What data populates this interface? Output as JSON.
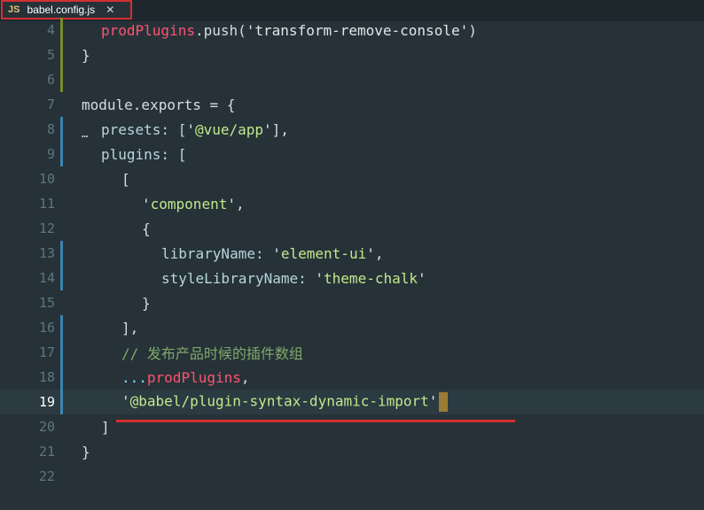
{
  "tab": {
    "icon_text": "JS",
    "filename": "babel.config.js",
    "close_glyph": "✕"
  },
  "fold_marker": "…",
  "lines": {
    "l4": {
      "num": "4",
      "fn": "prodPlugins",
      "rest": ".push(",
      "str": "'transform-remove-console'",
      "end": ")"
    },
    "l5": {
      "num": "5",
      "text": "}"
    },
    "l6": {
      "num": "6"
    },
    "l7": {
      "num": "7",
      "text": "module.exports = {"
    },
    "l8": {
      "num": "8",
      "key": "presets: [",
      "q1": "'",
      "str": "@vue/app",
      "q2": "'",
      "end": "],"
    },
    "l9": {
      "num": "9",
      "text": "plugins: ["
    },
    "l10": {
      "num": "10",
      "text": "["
    },
    "l11": {
      "num": "11",
      "q1": "'",
      "str": "component",
      "q2": "'",
      "end": ","
    },
    "l12": {
      "num": "12",
      "text": "{"
    },
    "l13": {
      "num": "13",
      "key": "libraryName: ",
      "q1": "'",
      "str": "element-ui",
      "q2": "'",
      "end": ","
    },
    "l14": {
      "num": "14",
      "key": "styleLibraryName: ",
      "q1": "'",
      "str": "theme-chalk",
      "q2": "'"
    },
    "l15": {
      "num": "15",
      "text": "}"
    },
    "l16": {
      "num": "16",
      "text": "],"
    },
    "l17": {
      "num": "17",
      "text": "// 发布产品时候的插件数组"
    },
    "l18": {
      "num": "18",
      "spread": "...",
      "fn": "prodPlugins",
      "end": ","
    },
    "l19": {
      "num": "19",
      "q1": "'",
      "str": "@babel/plugin-syntax-dynamic-import",
      "q2": "'"
    },
    "l20": {
      "num": "20",
      "text": "]"
    },
    "l21": {
      "num": "21",
      "text": "}"
    },
    "l22": {
      "num": "22"
    }
  },
  "colors": {
    "highlight_box": "#d32f2f",
    "background": "#263238"
  }
}
